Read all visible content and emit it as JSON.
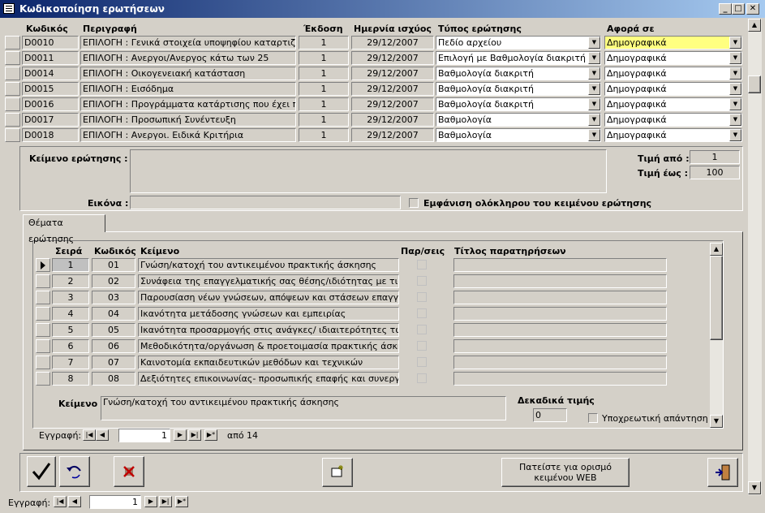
{
  "window": {
    "title": "Κωδικοποίηση ερωτήσεων",
    "min": "_",
    "max": "□",
    "close": "✕"
  },
  "header": {
    "code": "Κωδικός",
    "desc": "Περιγραφή",
    "version": "Έκδοση",
    "date": "Ημερνία ισχύος",
    "type": "Τύπος ερώτησης",
    "concerns": "Αφορά σε"
  },
  "rows": [
    {
      "code": "D0010",
      "desc": "ΕΠΙΛΟΓΗ : Γενικά στοιχεία υποψηφίου καταρτιζομένου",
      "version": "1",
      "date": "29/12/2007",
      "type": "Πεδίο αρχείου",
      "concerns": "Δημογραφικά"
    },
    {
      "code": "D0011",
      "desc": "ΕΠΙΛΟΓΗ : Ανεργοι/Ανεργος κάτω των 25",
      "version": "1",
      "date": "29/12/2007",
      "type": "Επιλογή με Βαθμολογία διακριτή",
      "concerns": "Δημογραφικά"
    },
    {
      "code": "D0014",
      "desc": "ΕΠΙΛΟΓΗ : Οικογενειακή κατάσταση",
      "version": "1",
      "date": "29/12/2007",
      "type": "Βαθμολογία διακριτή",
      "concerns": "Δημογραφικά"
    },
    {
      "code": "D0015",
      "desc": "ΕΠΙΛΟΓΗ : Εισόδημα",
      "version": "1",
      "date": "29/12/2007",
      "type": "Βαθμολογία διακριτή",
      "concerns": "Δημογραφικά"
    },
    {
      "code": "D0016",
      "desc": "ΕΠΙΛΟΓΗ : Προγράμματα κατάρτισης που έχει παρακολουθήσει",
      "version": "1",
      "date": "29/12/2007",
      "type": "Βαθμολογία διακριτή",
      "concerns": "Δημογραφικά"
    },
    {
      "code": "D0017",
      "desc": "ΕΠΙΛΟΓΗ : Προσωπική Συνέντευξη",
      "version": "1",
      "date": "29/12/2007",
      "type": "Βαθμολογία",
      "concerns": "Δημογραφικά"
    },
    {
      "code": "D0018",
      "desc": "ΕΠΙΛΟΓΗ : Ανεργοι. Ειδικά Κριτήρια",
      "version": "1",
      "date": "29/12/2007",
      "type": "Βαθμολογία",
      "concerns": "Δημογραφικά"
    }
  ],
  "detail": {
    "question_text_label": "Κείμενο ερώτησης :",
    "image_label": "Εικόνα :",
    "show_full_label": "Εμφάνιση ολόκληρου του κειμένου ερώτησης",
    "min_label": "Τιμή από :",
    "min_value": "1",
    "max_label": "Τιμή έως :",
    "max_value": "100"
  },
  "tab": {
    "label": "Θέματα ερώτησης"
  },
  "sub": {
    "header": {
      "order": "Σειρά",
      "code": "Κωδικός",
      "text": "Κείμενο",
      "notes": "Παρ/σεις",
      "notes_title": "Τίτλος παρατηρήσεων"
    },
    "rows": [
      {
        "order": "1",
        "code": "01",
        "text": "Γνώση/κατοχή του αντικειμένου πρακτικής άσκησης"
      },
      {
        "order": "2",
        "code": "02",
        "text": "Συνάφεια της επαγγελματικής σας θέσης/ιδιότητας  με τις δραστηριότητες"
      },
      {
        "order": "3",
        "code": "03",
        "text": "Παρουσίαση νέων γνώσεων, απόψεων και στάσεων επαγγελματικής συμπεριφοράς"
      },
      {
        "order": "4",
        "code": "04",
        "text": "Ικανότητα μετάδοσης γνώσεων και εμπειρίας"
      },
      {
        "order": "5",
        "code": "05",
        "text": "Ικανότητα προσαρμογής στις ανάγκες/ ιδιαιτερότητες των εκπαιδευομένων"
      },
      {
        "order": "6",
        "code": "06",
        "text": "Μεθοδικότητα/οργάνωση & προετοιμασία πρακτικής άσκησης"
      },
      {
        "order": "7",
        "code": "07",
        "text": "Καινοτομία εκπαιδευτικών μεθόδων και τεχνικών"
      },
      {
        "order": "8",
        "code": "08",
        "text": "Δεξιότητες επικοινωνίας- προσωπικής επαφής και συνεργασίας"
      }
    ],
    "text_label": "Κείμενο :",
    "text_value": "Γνώση/κατοχή του αντικειμένου πρακτικής άσκησης",
    "decimals_label": "Δεκαδικά τιμής",
    "decimals_value": "0",
    "required_label": "Υποχρεωτική απάντηση",
    "nav": {
      "label": "Εγγραφή:",
      "current": "1",
      "of": "από",
      "total": "14"
    }
  },
  "buttons": {
    "web_label": "Πατείστε για ορισμό κειμένου WEB"
  },
  "nav": {
    "label": "Εγγραφή:",
    "current": "1"
  },
  "colors": {
    "highlight": "#ffff80",
    "titlebar_start": "#0a246a",
    "titlebar_end": "#a6caf0"
  }
}
